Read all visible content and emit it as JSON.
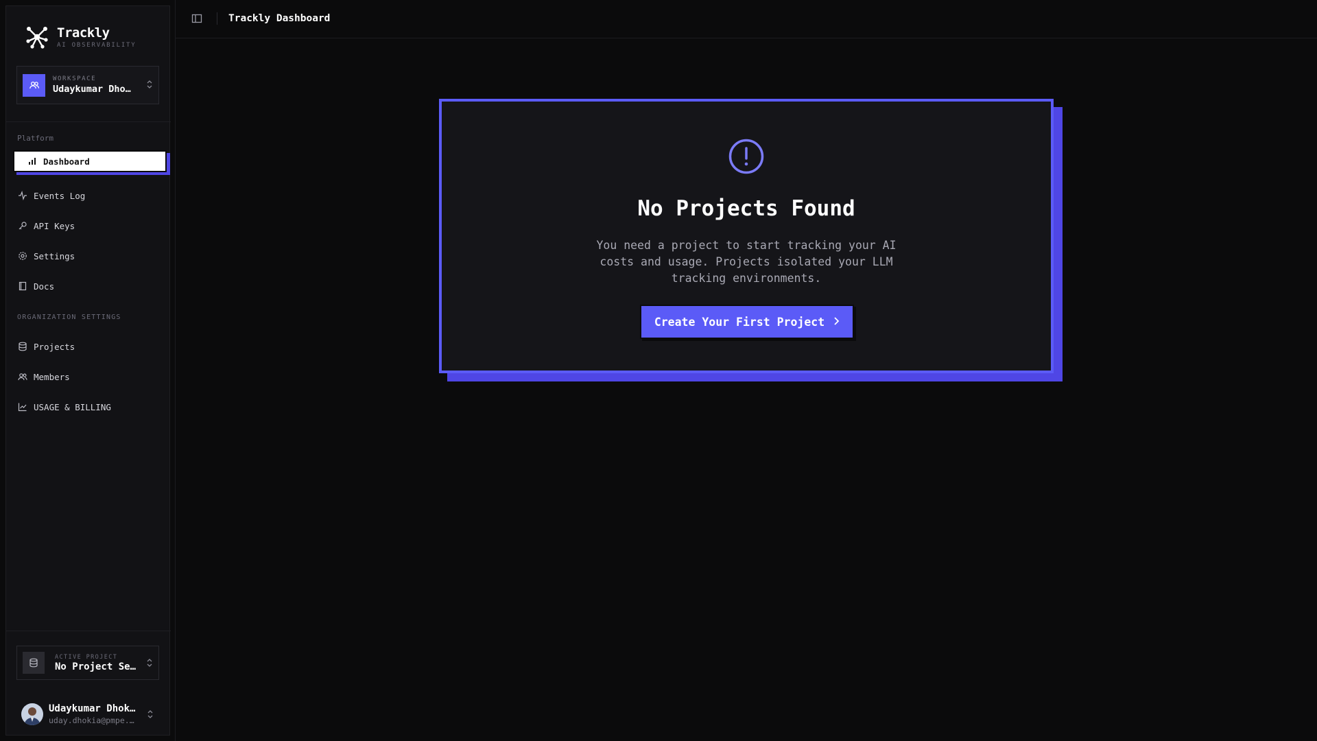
{
  "brand": {
    "title": "Trackly",
    "subtitle": "AI OBSERVABILITY"
  },
  "workspace": {
    "label": "WORKSPACE",
    "name": "Udaykumar Dhokia's Workspace"
  },
  "nav": {
    "platform_heading": "Platform",
    "platform_items": [
      {
        "label": "Dashboard",
        "icon": "bar-chart-icon",
        "active": true
      },
      {
        "label": "Events Log",
        "icon": "activity-icon"
      },
      {
        "label": "API Keys",
        "icon": "key-icon"
      },
      {
        "label": "Settings",
        "icon": "gear-icon"
      },
      {
        "label": "Docs",
        "icon": "book-icon"
      }
    ],
    "org_heading": "ORGANIZATION SETTINGS",
    "org_items": [
      {
        "label": "Projects",
        "icon": "database-icon"
      },
      {
        "label": "Members",
        "icon": "users-icon"
      },
      {
        "label": "USAGE & BILLING",
        "icon": "line-chart-icon"
      }
    ]
  },
  "active_project": {
    "label": "ACTIVE PROJECT",
    "name": "No Project Selected"
  },
  "user": {
    "name": "Udaykumar Dhokia",
    "email": "uday.dhokia@pmpe..."
  },
  "header": {
    "title": "Trackly Dashboard"
  },
  "empty_state": {
    "title": "No Projects Found",
    "description": "You need a project to start tracking your AI costs and usage. Projects isolated your LLM tracking environments.",
    "cta_label": "Create Your First Project"
  },
  "colors": {
    "accent": "#5b5bf7",
    "accent_shadow": "#4f46e5",
    "background": "#0b0b0c",
    "sidebar": "#121215"
  }
}
